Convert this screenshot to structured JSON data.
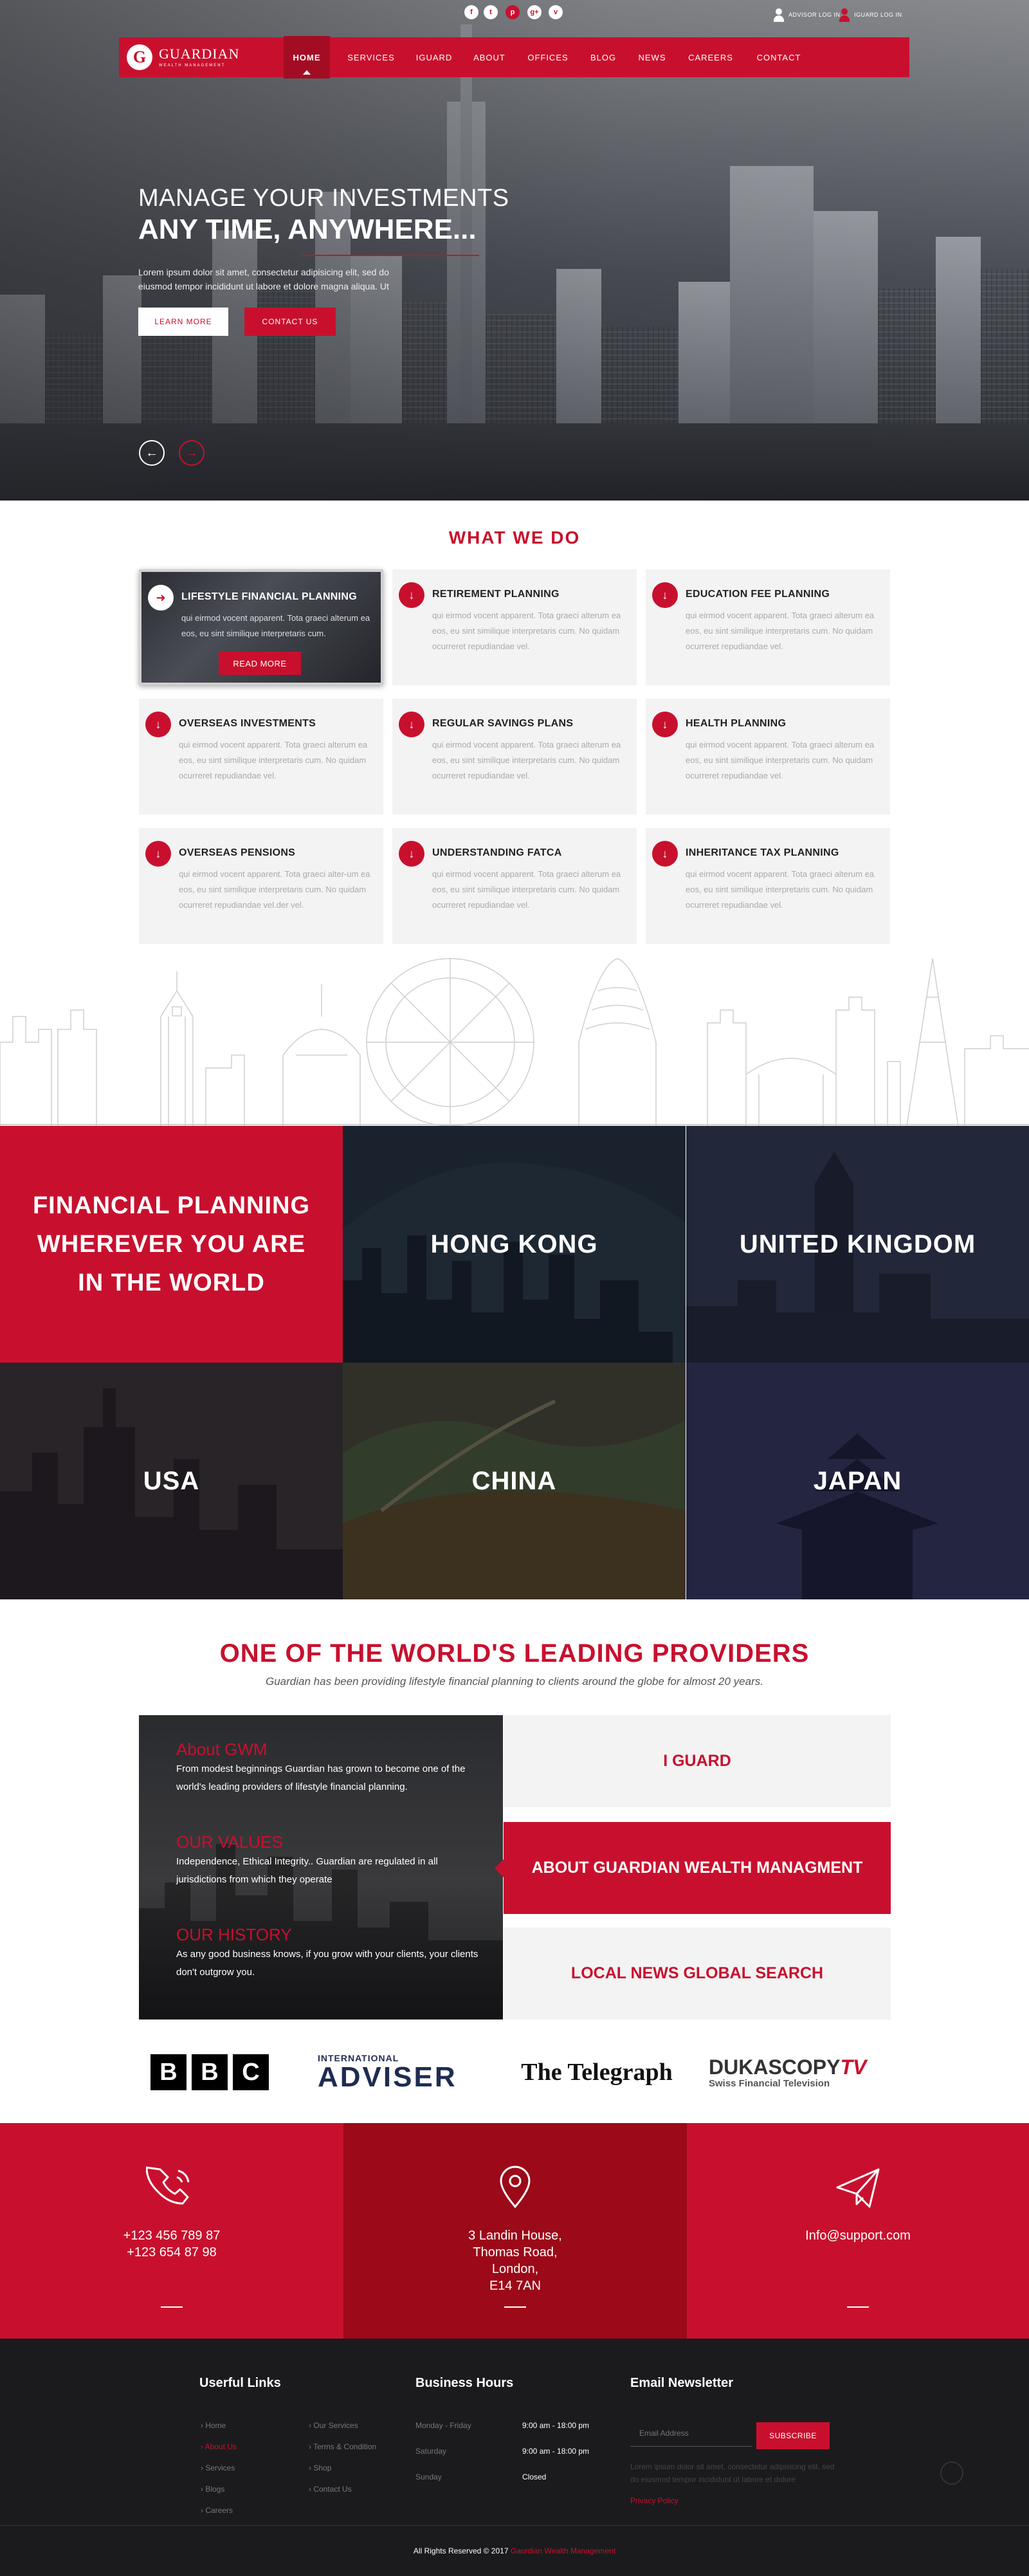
{
  "header": {
    "social": [
      "f",
      "t",
      "p",
      "g+",
      "v"
    ],
    "advisor_login": "ADVISOR LOG IN",
    "iguard_login": "IGUARD LOG IN",
    "logo_name": "GUARDIAN",
    "logo_sub": "WEALTH MANAGEMENT",
    "nav": [
      "HOME",
      "SERVICES",
      "IGUARD",
      "ABOUT",
      "OFFICES",
      "BLOG",
      "NEWS",
      "CAREERS",
      "CONTACT"
    ]
  },
  "hero": {
    "line1": "MANAGE YOUR INVESTMENTS",
    "line2": "ANY TIME, ANYWHERE...",
    "text": "Lorem ipsum dolor sit amet, consectetur adipisicing elit, sed do eiusmod tempor incididunt ut labore et dolore magna aliqua. Ut",
    "learn_more": "LEARN MORE",
    "contact_us": "CONTACT US"
  },
  "what_we_do": {
    "title": "WHAT WE DO",
    "read_more": "READ MORE",
    "cards": [
      {
        "title": "LIFESTYLE FINANCIAL PLANNING",
        "desc": "qui eirmod vocent apparent. Tota graeci alterum ea eos, eu sint similique interpretaris cum."
      },
      {
        "title": "RETIREMENT PLANNING",
        "desc": "qui eirmod vocent apparent. Tota graeci alterum ea eos, eu sint similique interpretaris cum. No quidam ocurreret repudiandae vel."
      },
      {
        "title": "EDUCATION FEE PLANNING",
        "desc": "qui eirmod vocent apparent. Tota graeci alterum ea eos, eu sint similique interpretaris cum. No quidam ocurreret repudiandae vel."
      },
      {
        "title": "OVERSEAS INVESTMENTS",
        "desc": "qui eirmod vocent apparent. Tota graeci alterum ea eos, eu sint similique interpretaris cum. No quidam ocurreret repudiandae vel."
      },
      {
        "title": "REGULAR SAVINGS PLANS",
        "desc": "qui eirmod vocent apparent. Tota graeci alterum ea eos, eu sint similique interpretaris cum. No quidam ocurreret repudiandae vel."
      },
      {
        "title": "HEALTH PLANNING",
        "desc": "qui eirmod vocent apparent. Tota graeci alterum ea eos, eu sint similique interpretaris cum. No quidam ocurreret repudiandae vel."
      },
      {
        "title": "OVERSEAS PENSIONS",
        "desc": "qui eirmod vocent apparent. Tota graeci alter-um ea eos, eu sint similique interpretaris cum. No quidam ocurreret repudiandae vel.der vel."
      },
      {
        "title": "UNDERSTANDING FATCA",
        "desc": "qui eirmod vocent apparent. Tota graeci alterum ea eos, eu sint similique interpretaris cum. No quidam ocurreret repudiandae vel."
      },
      {
        "title": "INHERITANCE TAX PLANNING",
        "desc": "qui eirmod vocent apparent. Tota graeci alterum ea eos, eu sint similique interpretaris cum. No quidam ocurreret repudiandae vel."
      }
    ]
  },
  "locations": {
    "lead": "FINANCIAL PLANNING WHEREVER YOU ARE IN THE WORLD",
    "items": [
      "HONG KONG",
      "UNITED KINGDOM",
      "USA",
      "CHINA",
      "JAPAN"
    ]
  },
  "providers": {
    "title": "ONE OF THE WORLD'S LEADING PROVIDERS",
    "subtitle": "Guardian has been providing lifestyle financial planning to clients around the globe for almost 20 years.",
    "about": [
      {
        "heading": "About GWM",
        "text": "From modest beginnings Guardian has grown to become one of the world's leading providers of lifestyle financial planning."
      },
      {
        "heading": "OUR VALUES",
        "text": "Independence, Ethical Integrity.. Guardian are regulated in all jurisdictions from which they operate"
      },
      {
        "heading": "OUR HISTORY",
        "text": "As any good business knows, if you grow with your clients, your clients don't outgrow you."
      }
    ],
    "tabs": [
      "I GUARD",
      "ABOUT GUARDIAN WEALTH MANAGMENT",
      "LOCAL NEWS GLOBAL SEARCH"
    ]
  },
  "media": {
    "bbc": [
      "B",
      "B",
      "C"
    ],
    "adviser_top": "INTERNATIONAL",
    "adviser_main": "ADVISER",
    "telegraph": "The Telegraph",
    "dukascopy": "DUKASCOPY",
    "dukascopy_tv": "TV",
    "dukascopy_sub": "Swiss Financial Television"
  },
  "contact": {
    "phone1": "+123 456 789 87",
    "phone2": "+123 654 87 98",
    "address": [
      "3 Landin House,",
      "Thomas Road,",
      "London,",
      "E14 7AN"
    ],
    "email": "Info@support.com"
  },
  "footer": {
    "links_title": "Userful Links",
    "links_col1": [
      "Home",
      "About Us",
      "Services",
      "Blogs",
      "Careers"
    ],
    "links_col2": [
      "Our Services",
      "Terms & Condition",
      "Shop",
      "Contact Us"
    ],
    "hours_title": "Business Hours",
    "hours": [
      {
        "day": "Monday - Friday",
        "time": "9:00 am - 18:00 pm"
      },
      {
        "day": "Saturday",
        "time": "9:00 am - 18:00 pm"
      },
      {
        "day": "Sunday",
        "time": "Closed"
      }
    ],
    "newsletter_title": "Email Newsletter",
    "email_placeholder": "Email Address",
    "subscribe": "SUBSCRIBE",
    "newsletter_text": "Lorem ipsum dolor sit amet, consectetur adipisicing elit, sed do eiusmod tempor incididunt ut labore et dolore",
    "privacy": "Privacy Policy",
    "copyright_pre": "All Rights Reserved © 2017",
    "copyright_brand": "Gaurdian Wealth Management"
  },
  "colors": {
    "accent": "#c8102e",
    "accent_dark": "#9c0919",
    "footer_bg": "#1b1b1d"
  }
}
